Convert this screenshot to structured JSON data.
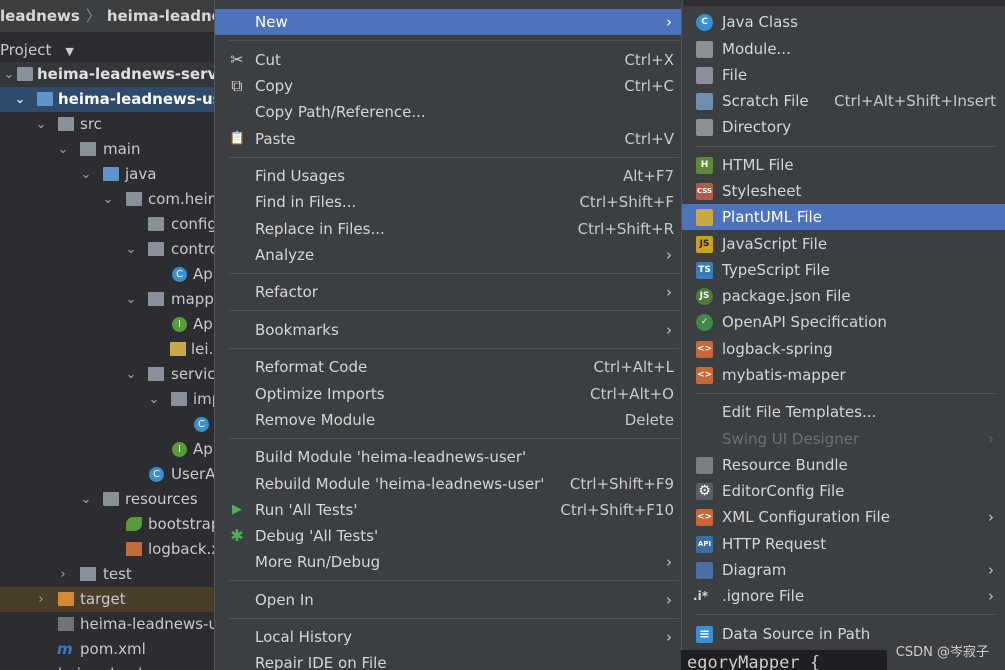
{
  "breadcrumb": {
    "project": "leadnews",
    "module": "heima-leadnews"
  },
  "project_panel": {
    "title": "Project"
  },
  "tree": [
    {
      "label": "heima-leadnews-service"
    },
    {
      "label": "heima-leadnews-user"
    },
    {
      "label": "src"
    },
    {
      "label": "main"
    },
    {
      "label": "java"
    },
    {
      "label": "com.heim"
    },
    {
      "label": "config"
    },
    {
      "label": "contro"
    },
    {
      "label": "Ap"
    },
    {
      "label": "mapp"
    },
    {
      "label": "Ap"
    },
    {
      "label": "lei.p"
    },
    {
      "label": "servic"
    },
    {
      "label": "imp"
    },
    {
      "label": "C"
    },
    {
      "label": "Ap"
    },
    {
      "label": "UserA"
    },
    {
      "label": "resources"
    },
    {
      "label": "bootstrap"
    },
    {
      "label": "logback.x"
    },
    {
      "label": "test"
    },
    {
      "label": "target"
    },
    {
      "label": "heima-leadnews-u"
    },
    {
      "label": "pom.xml"
    },
    {
      "label": "heima-leadn"
    }
  ],
  "menu": [
    {
      "label": "New",
      "shortcut": "",
      "arrow": "›"
    },
    {
      "label": "Cut",
      "shortcut": "Ctrl+X",
      "arrow": "",
      "icon": "✂"
    },
    {
      "label": "Copy",
      "shortcut": "Ctrl+C",
      "arrow": "",
      "icon": "⧉"
    },
    {
      "label": "Copy Path/Reference...",
      "shortcut": "",
      "arrow": ""
    },
    {
      "label": "Paste",
      "shortcut": "Ctrl+V",
      "arrow": "",
      "icon": "📋"
    },
    {
      "label": "Find Usages",
      "shortcut": "Alt+F7",
      "arrow": ""
    },
    {
      "label": "Find in Files...",
      "shortcut": "Ctrl+Shift+F",
      "arrow": ""
    },
    {
      "label": "Replace in Files...",
      "shortcut": "Ctrl+Shift+R",
      "arrow": ""
    },
    {
      "label": "Analyze",
      "shortcut": "",
      "arrow": "›"
    },
    {
      "label": "Refactor",
      "shortcut": "",
      "arrow": "›"
    },
    {
      "label": "Bookmarks",
      "shortcut": "",
      "arrow": "›"
    },
    {
      "label": "Reformat Code",
      "shortcut": "Ctrl+Alt+L",
      "arrow": ""
    },
    {
      "label": "Optimize Imports",
      "shortcut": "Ctrl+Alt+O",
      "arrow": ""
    },
    {
      "label": "Remove Module",
      "shortcut": "Delete",
      "arrow": ""
    },
    {
      "label": "Build Module 'heima-leadnews-user'",
      "shortcut": "",
      "arrow": ""
    },
    {
      "label": "Rebuild Module 'heima-leadnews-user'",
      "shortcut": "Ctrl+Shift+F9",
      "arrow": ""
    },
    {
      "label": "Run 'All Tests'",
      "shortcut": "Ctrl+Shift+F10",
      "arrow": "",
      "icon": "▶"
    },
    {
      "label": "Debug 'All Tests'",
      "shortcut": "",
      "arrow": "",
      "icon": "✱"
    },
    {
      "label": "More Run/Debug",
      "shortcut": "",
      "arrow": "›"
    },
    {
      "label": "Open In",
      "shortcut": "",
      "arrow": "›"
    },
    {
      "label": "Local History",
      "shortcut": "",
      "arrow": "›"
    },
    {
      "label": "Repair IDE on File",
      "shortcut": "",
      "arrow": ""
    }
  ],
  "submenu": [
    {
      "label": "Java Class",
      "shortcut": "",
      "arrow": "",
      "badge": "C",
      "color": "#3b8fd0"
    },
    {
      "label": "Module...",
      "shortcut": "",
      "arrow": "",
      "badge": "",
      "color": "#8a9099"
    },
    {
      "label": "File",
      "shortcut": "",
      "arrow": "",
      "badge": "",
      "color": "#8a9099"
    },
    {
      "label": "Scratch File",
      "shortcut": "Ctrl+Alt+Shift+Insert",
      "arrow": "",
      "badge": "",
      "color": "#6f8fb0"
    },
    {
      "label": "Directory",
      "shortcut": "",
      "arrow": "",
      "badge": "",
      "color": "#8a9099"
    },
    {
      "label": "HTML File",
      "shortcut": "",
      "arrow": "",
      "badge": "H",
      "color": "#5a8a3a"
    },
    {
      "label": "Stylesheet",
      "shortcut": "",
      "arrow": "",
      "badge": "CSS",
      "color": "#b05a4a"
    },
    {
      "label": "PlantUML File",
      "shortcut": "",
      "arrow": "",
      "badge": "",
      "color": "#c9a84a"
    },
    {
      "label": "JavaScript File",
      "shortcut": "",
      "arrow": "",
      "badge": "JS",
      "color": "#c9a030"
    },
    {
      "label": "TypeScript File",
      "shortcut": "",
      "arrow": "",
      "badge": "TS",
      "color": "#3b7ab8"
    },
    {
      "label": "package.json File",
      "shortcut": "",
      "arrow": "",
      "badge": "JS",
      "color": "#4f7a3a"
    },
    {
      "label": "OpenAPI Specification",
      "shortcut": "",
      "arrow": "",
      "badge": "✓",
      "color": "#3f8a4a"
    },
    {
      "label": "logback-spring",
      "shortcut": "",
      "arrow": "",
      "badge": "<>",
      "color": "#c46a3a"
    },
    {
      "label": "mybatis-mapper",
      "shortcut": "",
      "arrow": "",
      "badge": "<>",
      "color": "#c46a3a"
    },
    {
      "label": "Edit File Templates...",
      "shortcut": "",
      "arrow": "",
      "badge": "",
      "color": ""
    },
    {
      "label": "Swing UI Designer",
      "shortcut": "",
      "arrow": "›",
      "badge": "",
      "color": ""
    },
    {
      "label": "Resource Bundle",
      "shortcut": "",
      "arrow": "",
      "badge": "",
      "color": "#7a7f86"
    },
    {
      "label": "EditorConfig File",
      "shortcut": "",
      "arrow": "",
      "badge": "⚙",
      "color": "#5a5e63"
    },
    {
      "label": "XML Configuration File",
      "shortcut": "",
      "arrow": "›",
      "badge": "<>",
      "color": "#c46a3a"
    },
    {
      "label": "HTTP Request",
      "shortcut": "",
      "arrow": "",
      "badge": "API",
      "color": "#3b6fa0"
    },
    {
      "label": "Diagram",
      "shortcut": "",
      "arrow": "›",
      "badge": "",
      "color": "#4a6fa5"
    },
    {
      "label": ".ignore File",
      "shortcut": "",
      "arrow": "›",
      "badge": ".i*",
      "color": "#3c3f41"
    },
    {
      "label": "Data Source in Path",
      "shortcut": "",
      "arrow": "",
      "badge": "≡",
      "color": "#3b8fd0"
    }
  ],
  "code_peek": "egoryMapper {",
  "watermark": "CSDN @岑寂子",
  "colors": {
    "menu_bg": "#3c3f41",
    "highlight": "#4e73ba",
    "ide_bg": "#2b2d30"
  }
}
